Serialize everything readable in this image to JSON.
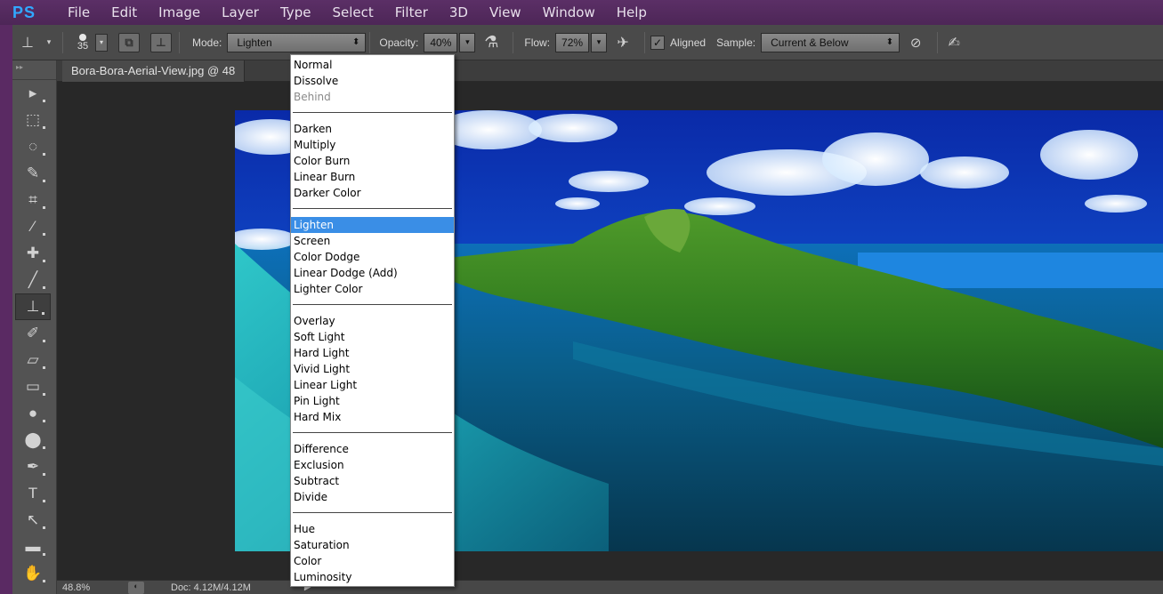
{
  "app": {
    "logo": "PS"
  },
  "menu": [
    "File",
    "Edit",
    "Image",
    "Layer",
    "Type",
    "Select",
    "Filter",
    "3D",
    "View",
    "Window",
    "Help"
  ],
  "options": {
    "brush_size": "35",
    "mode_label": "Mode:",
    "mode_value": "Lighten",
    "opacity_label": "Opacity:",
    "opacity_value": "40%",
    "flow_label": "Flow:",
    "flow_value": "72%",
    "aligned_label": "Aligned",
    "aligned_checked": true,
    "sample_label": "Sample:",
    "sample_value": "Current & Below"
  },
  "document": {
    "tab_title": "Bora-Bora-Aerial-View.jpg @ 48"
  },
  "status": {
    "zoom": "48.8%",
    "doc": "Doc: 4.12M/4.12M"
  },
  "blend_modes": [
    {
      "label": "Normal"
    },
    {
      "label": "Dissolve"
    },
    {
      "label": "Behind",
      "disabled": true
    },
    {
      "separator": true
    },
    {
      "label": "Darken"
    },
    {
      "label": "Multiply"
    },
    {
      "label": "Color Burn"
    },
    {
      "label": "Linear Burn"
    },
    {
      "label": "Darker Color"
    },
    {
      "separator": true
    },
    {
      "label": "Lighten",
      "selected": true
    },
    {
      "label": "Screen"
    },
    {
      "label": "Color Dodge"
    },
    {
      "label": "Linear Dodge (Add)"
    },
    {
      "label": "Lighter Color"
    },
    {
      "separator": true
    },
    {
      "label": "Overlay"
    },
    {
      "label": "Soft Light"
    },
    {
      "label": "Hard Light"
    },
    {
      "label": "Vivid Light"
    },
    {
      "label": "Linear Light"
    },
    {
      "label": "Pin Light"
    },
    {
      "label": "Hard Mix"
    },
    {
      "separator": true
    },
    {
      "label": "Difference"
    },
    {
      "label": "Exclusion"
    },
    {
      "label": "Subtract"
    },
    {
      "label": "Divide"
    },
    {
      "separator": true
    },
    {
      "label": "Hue"
    },
    {
      "label": "Saturation"
    },
    {
      "label": "Color"
    },
    {
      "label": "Luminosity"
    }
  ],
  "tools": [
    {
      "icon": "move-icon",
      "glyph": "▸"
    },
    {
      "icon": "marquee-icon",
      "glyph": "⬚"
    },
    {
      "icon": "lasso-icon",
      "glyph": "◌"
    },
    {
      "icon": "quick-select-icon",
      "glyph": "✎"
    },
    {
      "icon": "crop-icon",
      "glyph": "⌗"
    },
    {
      "icon": "eyedropper-icon",
      "glyph": "⁄"
    },
    {
      "icon": "healing-brush-icon",
      "glyph": "✚"
    },
    {
      "icon": "brush-icon",
      "glyph": "╱"
    },
    {
      "icon": "clone-stamp-icon",
      "glyph": "⊥",
      "active": true
    },
    {
      "icon": "history-brush-icon",
      "glyph": "✐"
    },
    {
      "icon": "eraser-icon",
      "glyph": "▱"
    },
    {
      "icon": "gradient-icon",
      "glyph": "▭"
    },
    {
      "icon": "blur-icon",
      "glyph": "●"
    },
    {
      "icon": "dodge-icon",
      "glyph": "⬤"
    },
    {
      "icon": "pen-icon",
      "glyph": "✒"
    },
    {
      "icon": "type-icon",
      "glyph": "T"
    },
    {
      "icon": "path-select-icon",
      "glyph": "↖"
    },
    {
      "icon": "rectangle-icon",
      "glyph": "▬"
    },
    {
      "icon": "hand-icon",
      "glyph": "✋"
    }
  ]
}
